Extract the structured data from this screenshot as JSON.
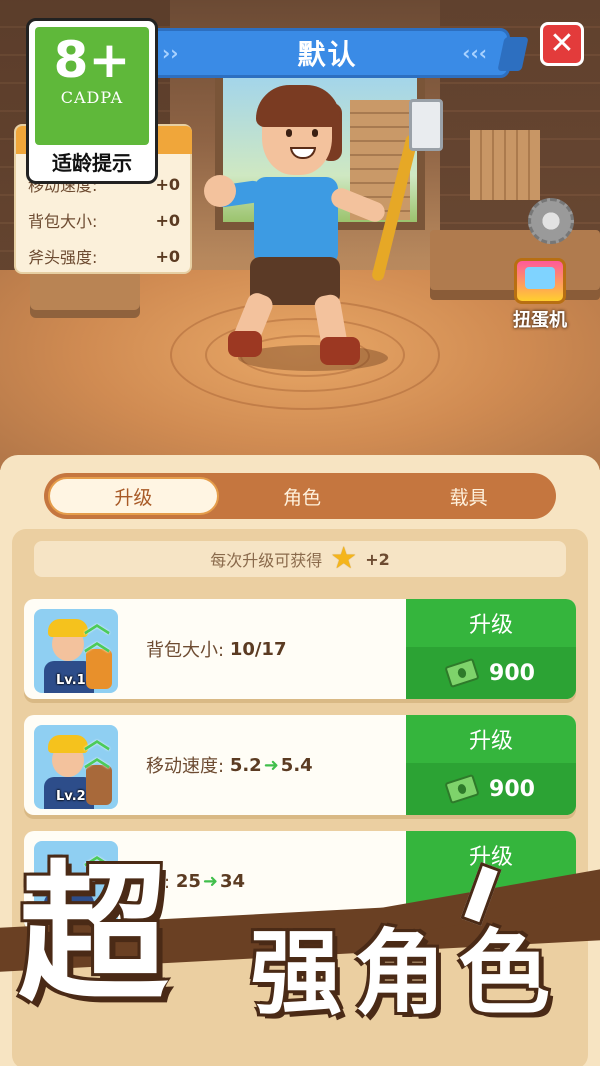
{
  "header": {
    "title": "默认",
    "chevrons_left": "››",
    "chevrons_right": "‹‹‹",
    "close_label": "✕"
  },
  "rating": {
    "age": "8+",
    "org": "CADPA",
    "hint": "适龄提示"
  },
  "stats": [
    {
      "label": "移动速度:",
      "value": "+0"
    },
    {
      "label": "背包大小:",
      "value": "+0"
    },
    {
      "label": "斧头强度:",
      "value": "+0"
    }
  ],
  "gacha": {
    "label": "扭蛋机",
    "icon": "gacha-machine-icon"
  },
  "tabs": [
    {
      "label": "升级",
      "active": true
    },
    {
      "label": "角色",
      "active": false
    },
    {
      "label": "载具",
      "active": false
    }
  ],
  "bonus": {
    "text": "每次升级可获得",
    "icon": "star-icon",
    "amount": "+2"
  },
  "upgrades": [
    {
      "level": "Lv.1",
      "label": "背包大小:",
      "from": "10/17",
      "to": "",
      "button": "升级",
      "cost": "900"
    },
    {
      "level": "Lv.2",
      "label": "移动速度:",
      "from": "5.2",
      "to": "5.4",
      "button": "升级",
      "cost": "900"
    },
    {
      "level": "",
      "label": "度:",
      "from": "25",
      "to": "34",
      "button": "升级",
      "cost": ""
    }
  ],
  "promo": {
    "big": "超",
    "rest": "强角色"
  },
  "colors": {
    "title_blue": "#3a8be6",
    "close_red": "#e33b3b",
    "upgrade_green": "#35b53d",
    "tab_brown": "#c5763f",
    "panel_bg": "#f7e4c2",
    "rating_green": "#5fb83a"
  }
}
